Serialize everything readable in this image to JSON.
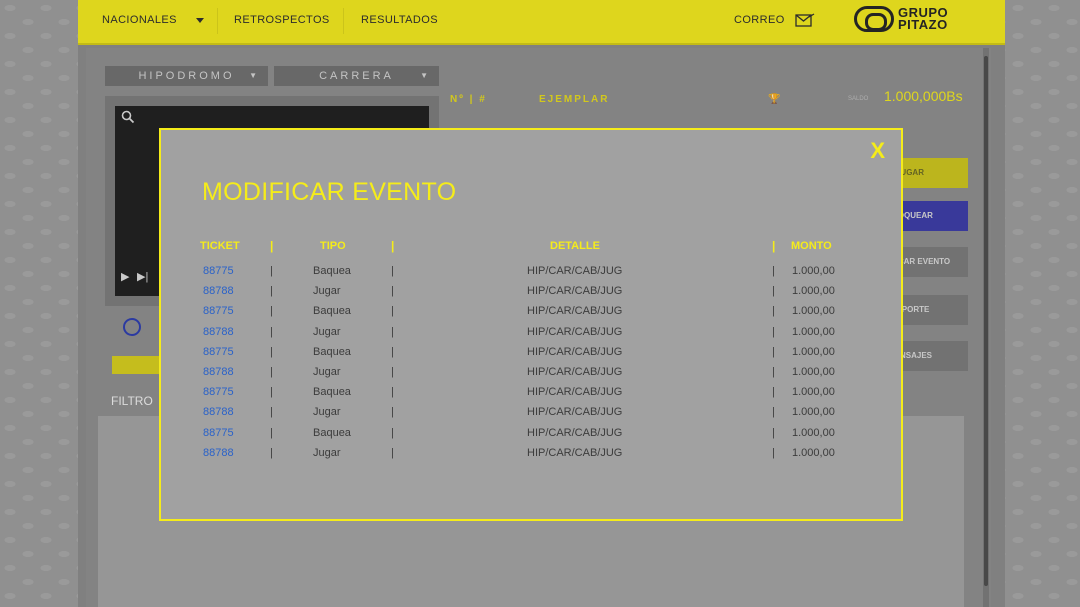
{
  "topbar": {
    "nav": [
      "NACIONALES",
      "RETROSPECTOS",
      "RESULTADOS"
    ],
    "correo": "CORREO",
    "logo": [
      "GRUPO",
      "PITAZO"
    ]
  },
  "selectors": {
    "hipodromo": "HIPODROMO",
    "carrera": "CARRERA"
  },
  "columns": {
    "numero": "Nº | #",
    "ejemplar": "EJEMPLAR"
  },
  "balance": {
    "label": "SALDO",
    "value": "1.000,000Bs"
  },
  "side_buttons": [
    "JUGAR",
    "BLOQUEAR",
    "MODIFICAR EVENTO",
    "REPORTE",
    "MENSAJES"
  ],
  "filtro": "FILTRO",
  "modal": {
    "close": "X",
    "title": "MODIFICAR EVENTO",
    "headers": {
      "ticket": "TICKET",
      "tipo": "TIPO",
      "detalle": "DETALLE",
      "monto": "MONTO"
    },
    "rows": [
      {
        "ticket": "88775",
        "tipo": "Baquea",
        "detalle": "HIP/CAR/CAB/JUG",
        "monto": "1.000,00"
      },
      {
        "ticket": "88788",
        "tipo": "Jugar",
        "detalle": "HIP/CAR/CAB/JUG",
        "monto": "1.000,00"
      },
      {
        "ticket": "88775",
        "tipo": "Baquea",
        "detalle": "HIP/CAR/CAB/JUG",
        "monto": "1.000,00"
      },
      {
        "ticket": "88788",
        "tipo": "Jugar",
        "detalle": "HIP/CAR/CAB/JUG",
        "monto": "1.000,00"
      },
      {
        "ticket": "88775",
        "tipo": "Baquea",
        "detalle": "HIP/CAR/CAB/JUG",
        "monto": "1.000,00"
      },
      {
        "ticket": "88788",
        "tipo": "Jugar",
        "detalle": "HIP/CAR/CAB/JUG",
        "monto": "1.000,00"
      },
      {
        "ticket": "88775",
        "tipo": "Baquea",
        "detalle": "HIP/CAR/CAB/JUG",
        "monto": "1.000,00"
      },
      {
        "ticket": "88788",
        "tipo": "Jugar",
        "detalle": "HIP/CAR/CAB/JUG",
        "monto": "1.000,00"
      },
      {
        "ticket": "88775",
        "tipo": "Baquea",
        "detalle": "HIP/CAR/CAB/JUG",
        "monto": "1.000,00"
      },
      {
        "ticket": "88788",
        "tipo": "Jugar",
        "detalle": "HIP/CAR/CAB/JUG",
        "monto": "1.000,00"
      }
    ]
  },
  "colors": {
    "accent": "#f5ec1a",
    "link": "#2a62c9",
    "modal_bg": "#a1a1a1"
  }
}
